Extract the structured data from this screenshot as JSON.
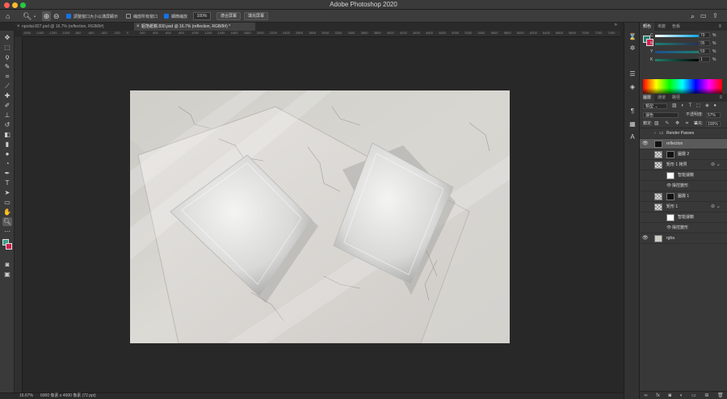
{
  "app": {
    "title": "Adobe Photoshop 2020"
  },
  "options": {
    "zoom_tool_icon": "zoom-in-icon",
    "chk1": "調整窗口大小以滿屏顯示",
    "chk2": "縮放所有窗口",
    "chk3": "細微縮放",
    "zoom": "100%",
    "fit": "適合屏幕",
    "fill": "填充屏幕"
  },
  "tabs": [
    {
      "label": "npzdai.827.psd @ 16.7% (reflection, RGB/8#)"
    },
    {
      "label": "鋁箔紙鏡.830.psd @ 16.7% (reflection, RGB/8#) *"
    }
  ],
  "ruler": [
    "-1600",
    "-1400",
    "-1200",
    "-1000",
    "-800",
    "-600",
    "-400",
    "-200",
    "0",
    "200",
    "400",
    "600",
    "800",
    "1000",
    "1200",
    "1400",
    "1600",
    "1800",
    "2000",
    "2200",
    "2400",
    "2600",
    "2800",
    "3000",
    "3200",
    "3400",
    "3600",
    "3800",
    "4000",
    "4200",
    "4400",
    "4600",
    "4800",
    "5000",
    "5200",
    "5400",
    "5600",
    "5800",
    "6000",
    "6200",
    "6400",
    "6600",
    "6800",
    "7000",
    "7200",
    "7400",
    "7600"
  ],
  "color": {
    "tabs": [
      "顏色",
      "漸變",
      "色板"
    ],
    "c": "79",
    "m": "95",
    "y": "59",
    "k": "1",
    "pct": "%",
    "fg": "#1f7f6e",
    "bg": "#d11f4e"
  },
  "layers": {
    "tabs": [
      "圖層",
      "通道",
      "路徑"
    ],
    "kind": "類型",
    "blend": "濾色",
    "opacity_label": "不透明度:",
    "opacity": "57%",
    "lock_label": "鎖定:",
    "fill_label": "填充:",
    "fill": "100%",
    "items": [
      {
        "name": "Render Passes"
      },
      {
        "name": "reflection"
      },
      {
        "name": "圖層 2"
      },
      {
        "name": "矩形 1 拷貝"
      },
      {
        "name": "智能濾鏡"
      },
      {
        "name": "操控變形"
      },
      {
        "name": "圖層 1"
      },
      {
        "name": "矩形 1"
      },
      {
        "name": "智能濾鏡"
      },
      {
        "name": "操控變形"
      },
      {
        "name": "rgba"
      }
    ]
  },
  "status": {
    "zoom": "16.67%",
    "size": "6000 像素 x 4000 像素 (72 ppi)"
  }
}
